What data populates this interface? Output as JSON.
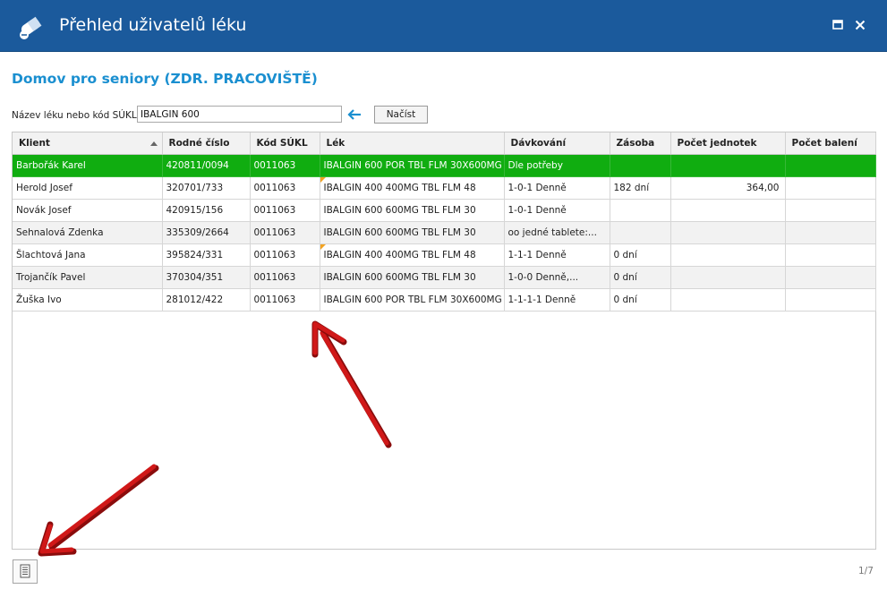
{
  "window": {
    "title": "Přehled uživatelů léku",
    "icon": "pill-capsule-icon",
    "buttons": [
      "maximize-icon",
      "close-icon"
    ]
  },
  "heading": "Domov pro seniory (ZDR. PRACOVIŠTĚ)",
  "search": {
    "label": "Název léku nebo kód SÚKL:",
    "value": "IBALGIN 600",
    "arrow_icon": "arrow-left-icon",
    "load_label": "Načíst"
  },
  "table": {
    "columns": [
      "Klient",
      "Rodné číslo",
      "Kód SÚKL",
      "Lék",
      "Dávkování",
      "Zásoba",
      "Počet jednotek",
      "Počet balení"
    ],
    "sorted_column": "Klient",
    "rows": [
      [
        "Barbořák Karel",
        "420811/0094",
        "0011063",
        "IBALGIN 600 POR TBL FLM 30X600MG",
        "Dle potřeby",
        "",
        "",
        ""
      ],
      [
        "Herold Josef",
        "320701/733",
        "0011063",
        "IBALGIN 400 400MG TBL FLM 48",
        "1-0-1 Denně",
        "182 dní",
        "364,00",
        ""
      ],
      [
        "Novák Josef",
        "420915/156",
        "0011063",
        "IBALGIN 600 600MG TBL FLM 30",
        "1-0-1 Denně",
        "",
        "",
        ""
      ],
      [
        "Sehnalová Zdenka",
        "335309/2664",
        "0011063",
        "IBALGIN 600 600MG TBL FLM 30",
        "oo jedné tablete:...",
        "",
        "",
        ""
      ],
      [
        "Šlachtová Jana",
        "395824/331",
        "0011063",
        "IBALGIN 400 400MG TBL FLM 48",
        "1-1-1 Denně",
        "0 dní",
        "",
        ""
      ],
      [
        "Trojančík Pavel",
        "370304/351",
        "0011063",
        "IBALGIN 600 600MG TBL FLM 30",
        "1-0-0 Denně,...",
        "0 dní",
        "",
        ""
      ],
      [
        "Žuška Ivo",
        "281012/422",
        "0011063",
        "IBALGIN 600 POR TBL FLM 30X600MG",
        "1-1-1-1 Denně",
        "0 dní",
        "",
        ""
      ]
    ],
    "selected_row_color": "#10ad10"
  },
  "footer": {
    "report_icon": "document-icon",
    "page_indicator": "1/7"
  },
  "colors": {
    "titlebar": "#1b5a9c",
    "heading": "#1a8fd0",
    "annotation_arrow": "#d01818"
  }
}
